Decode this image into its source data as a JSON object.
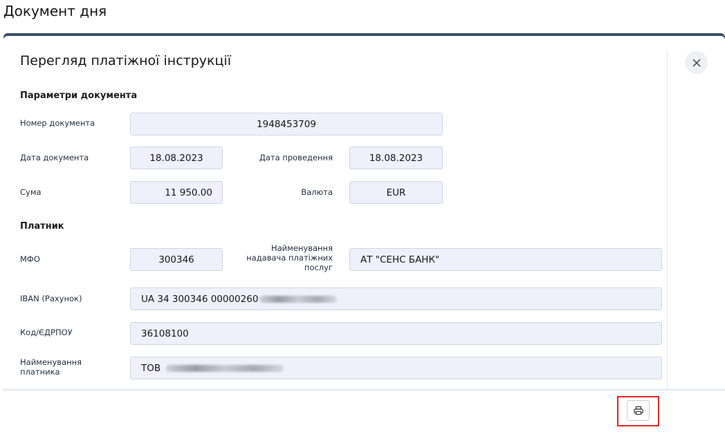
{
  "page": {
    "title": "Документ дня"
  },
  "modal": {
    "title": "Перегляд платіжної інструкції",
    "close_icon": "close-icon",
    "print_icon": "printer-icon",
    "sections": {
      "document": {
        "title": "Параметри документа",
        "number_label": "Номер документа",
        "number_value": "1948453709",
        "date_label": "Дата документа",
        "date_value": "18.08.2023",
        "posting_date_label": "Дата проведення",
        "posting_date_value": "18.08.2023",
        "amount_label": "Сума",
        "amount_value": "11 950.00",
        "currency_label": "Валюта",
        "currency_value": "EUR"
      },
      "payer": {
        "title": "Платник",
        "mfo_label": "МФО",
        "mfo_value": "300346",
        "provider_label_l1": "Найменування",
        "provider_label_l2": "надавача платіжних",
        "provider_label_l3": "послуг",
        "provider_value": "АТ \"СЕНС БАНК\"",
        "iban_label": "IBAN (Рахунок)",
        "iban_value": "UA 34 300346 00000260",
        "code_label": "Код/ЄДРПОУ",
        "code_value": "36108100",
        "name_label_l1": "Найменування",
        "name_label_l2": "платника",
        "name_value": "ТОВ"
      }
    }
  },
  "colors": {
    "header_bar": "#3b4e63",
    "field_bg": "#eef1fa",
    "highlight": "#e02020"
  }
}
